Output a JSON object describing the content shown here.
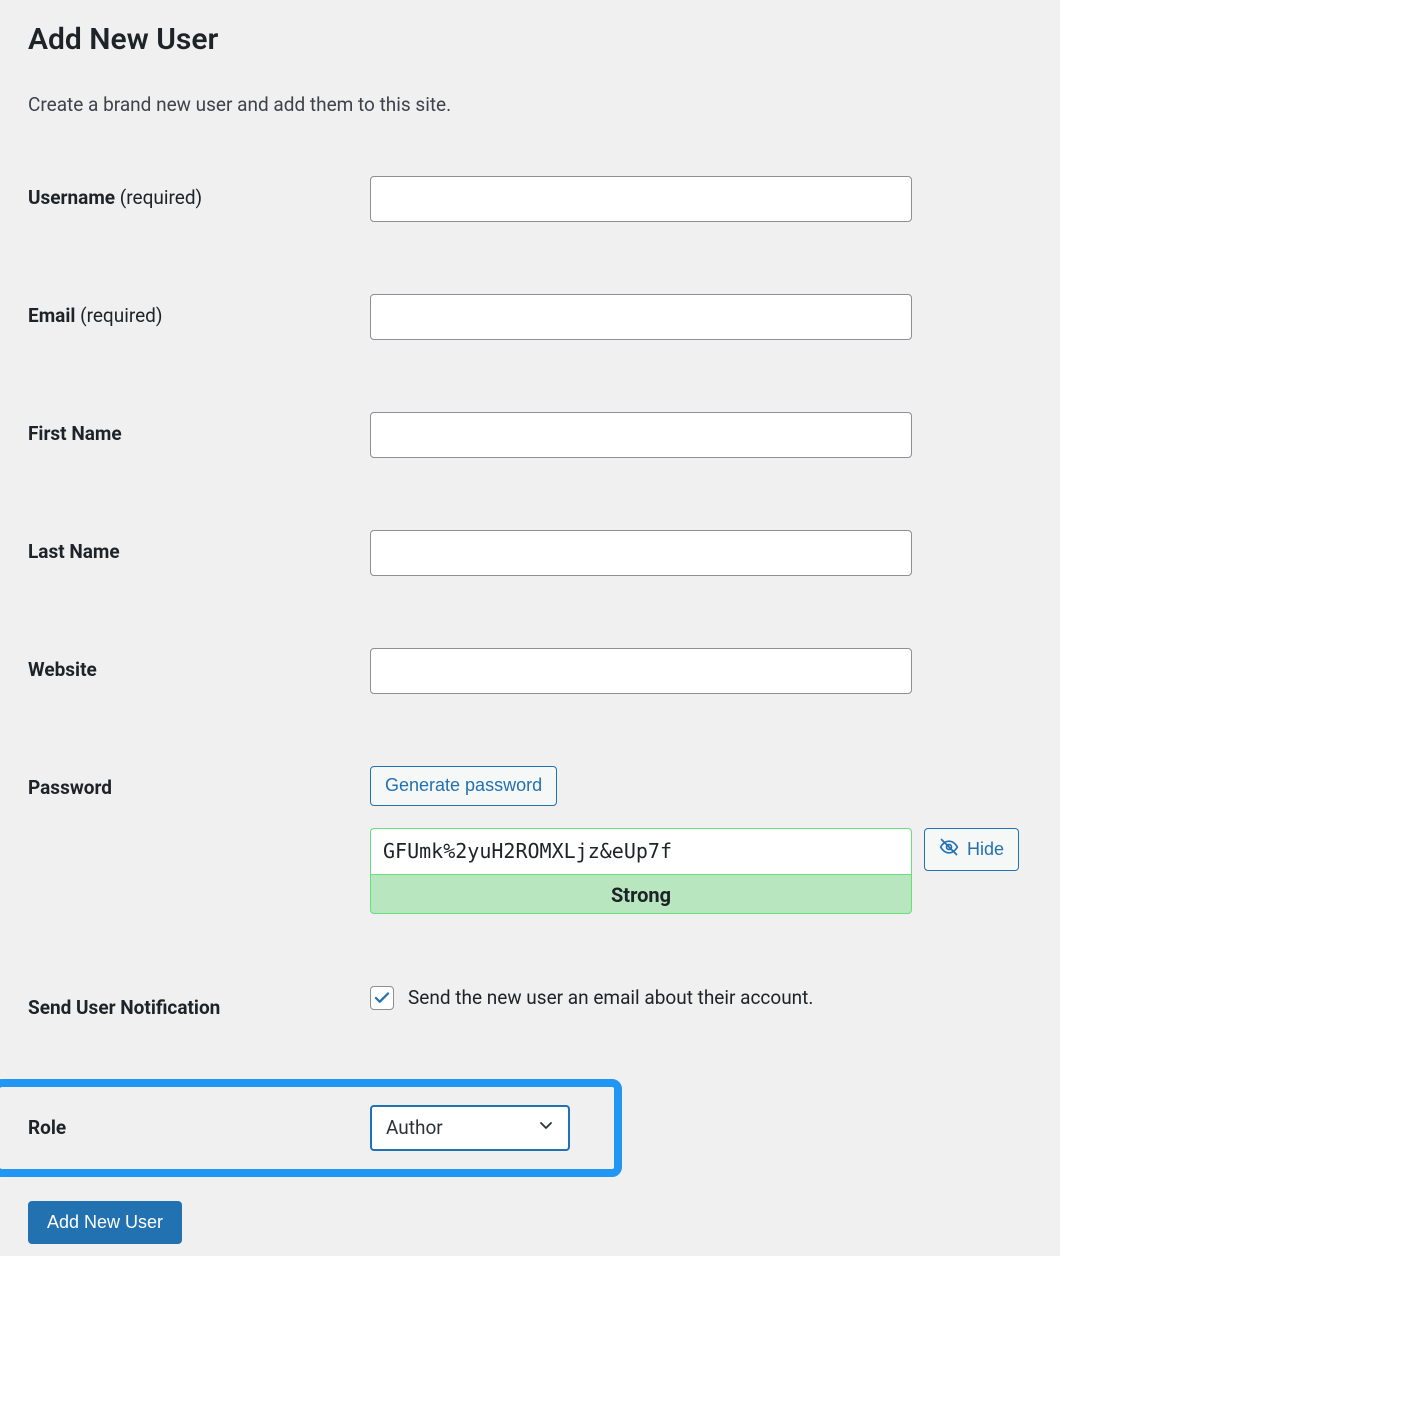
{
  "page": {
    "title": "Add New User",
    "description": "Create a brand new user and add them to this site."
  },
  "fields": {
    "username": {
      "label": "Username ",
      "required_text": "(required)",
      "value": ""
    },
    "email": {
      "label": "Email ",
      "required_text": "(required)",
      "value": ""
    },
    "first_name": {
      "label": "First Name",
      "value": ""
    },
    "last_name": {
      "label": "Last Name",
      "value": ""
    },
    "website": {
      "label": "Website",
      "value": ""
    },
    "password": {
      "label": "Password",
      "generate_button": "Generate password",
      "value": "GFUmk%2yuH2ROMXLjz&eUp7f",
      "strength": "Strong",
      "hide_button": "Hide"
    },
    "notification": {
      "label": "Send User Notification",
      "checked": true,
      "checkbox_text": "Send the new user an email about their account."
    },
    "role": {
      "label": "Role",
      "selected": "Author"
    }
  },
  "submit": {
    "label": "Add New User"
  },
  "colors": {
    "accent": "#2271b1",
    "highlight_border": "#2196f3",
    "strength_bg": "#b8e6bf",
    "strength_border": "#68de7c"
  }
}
